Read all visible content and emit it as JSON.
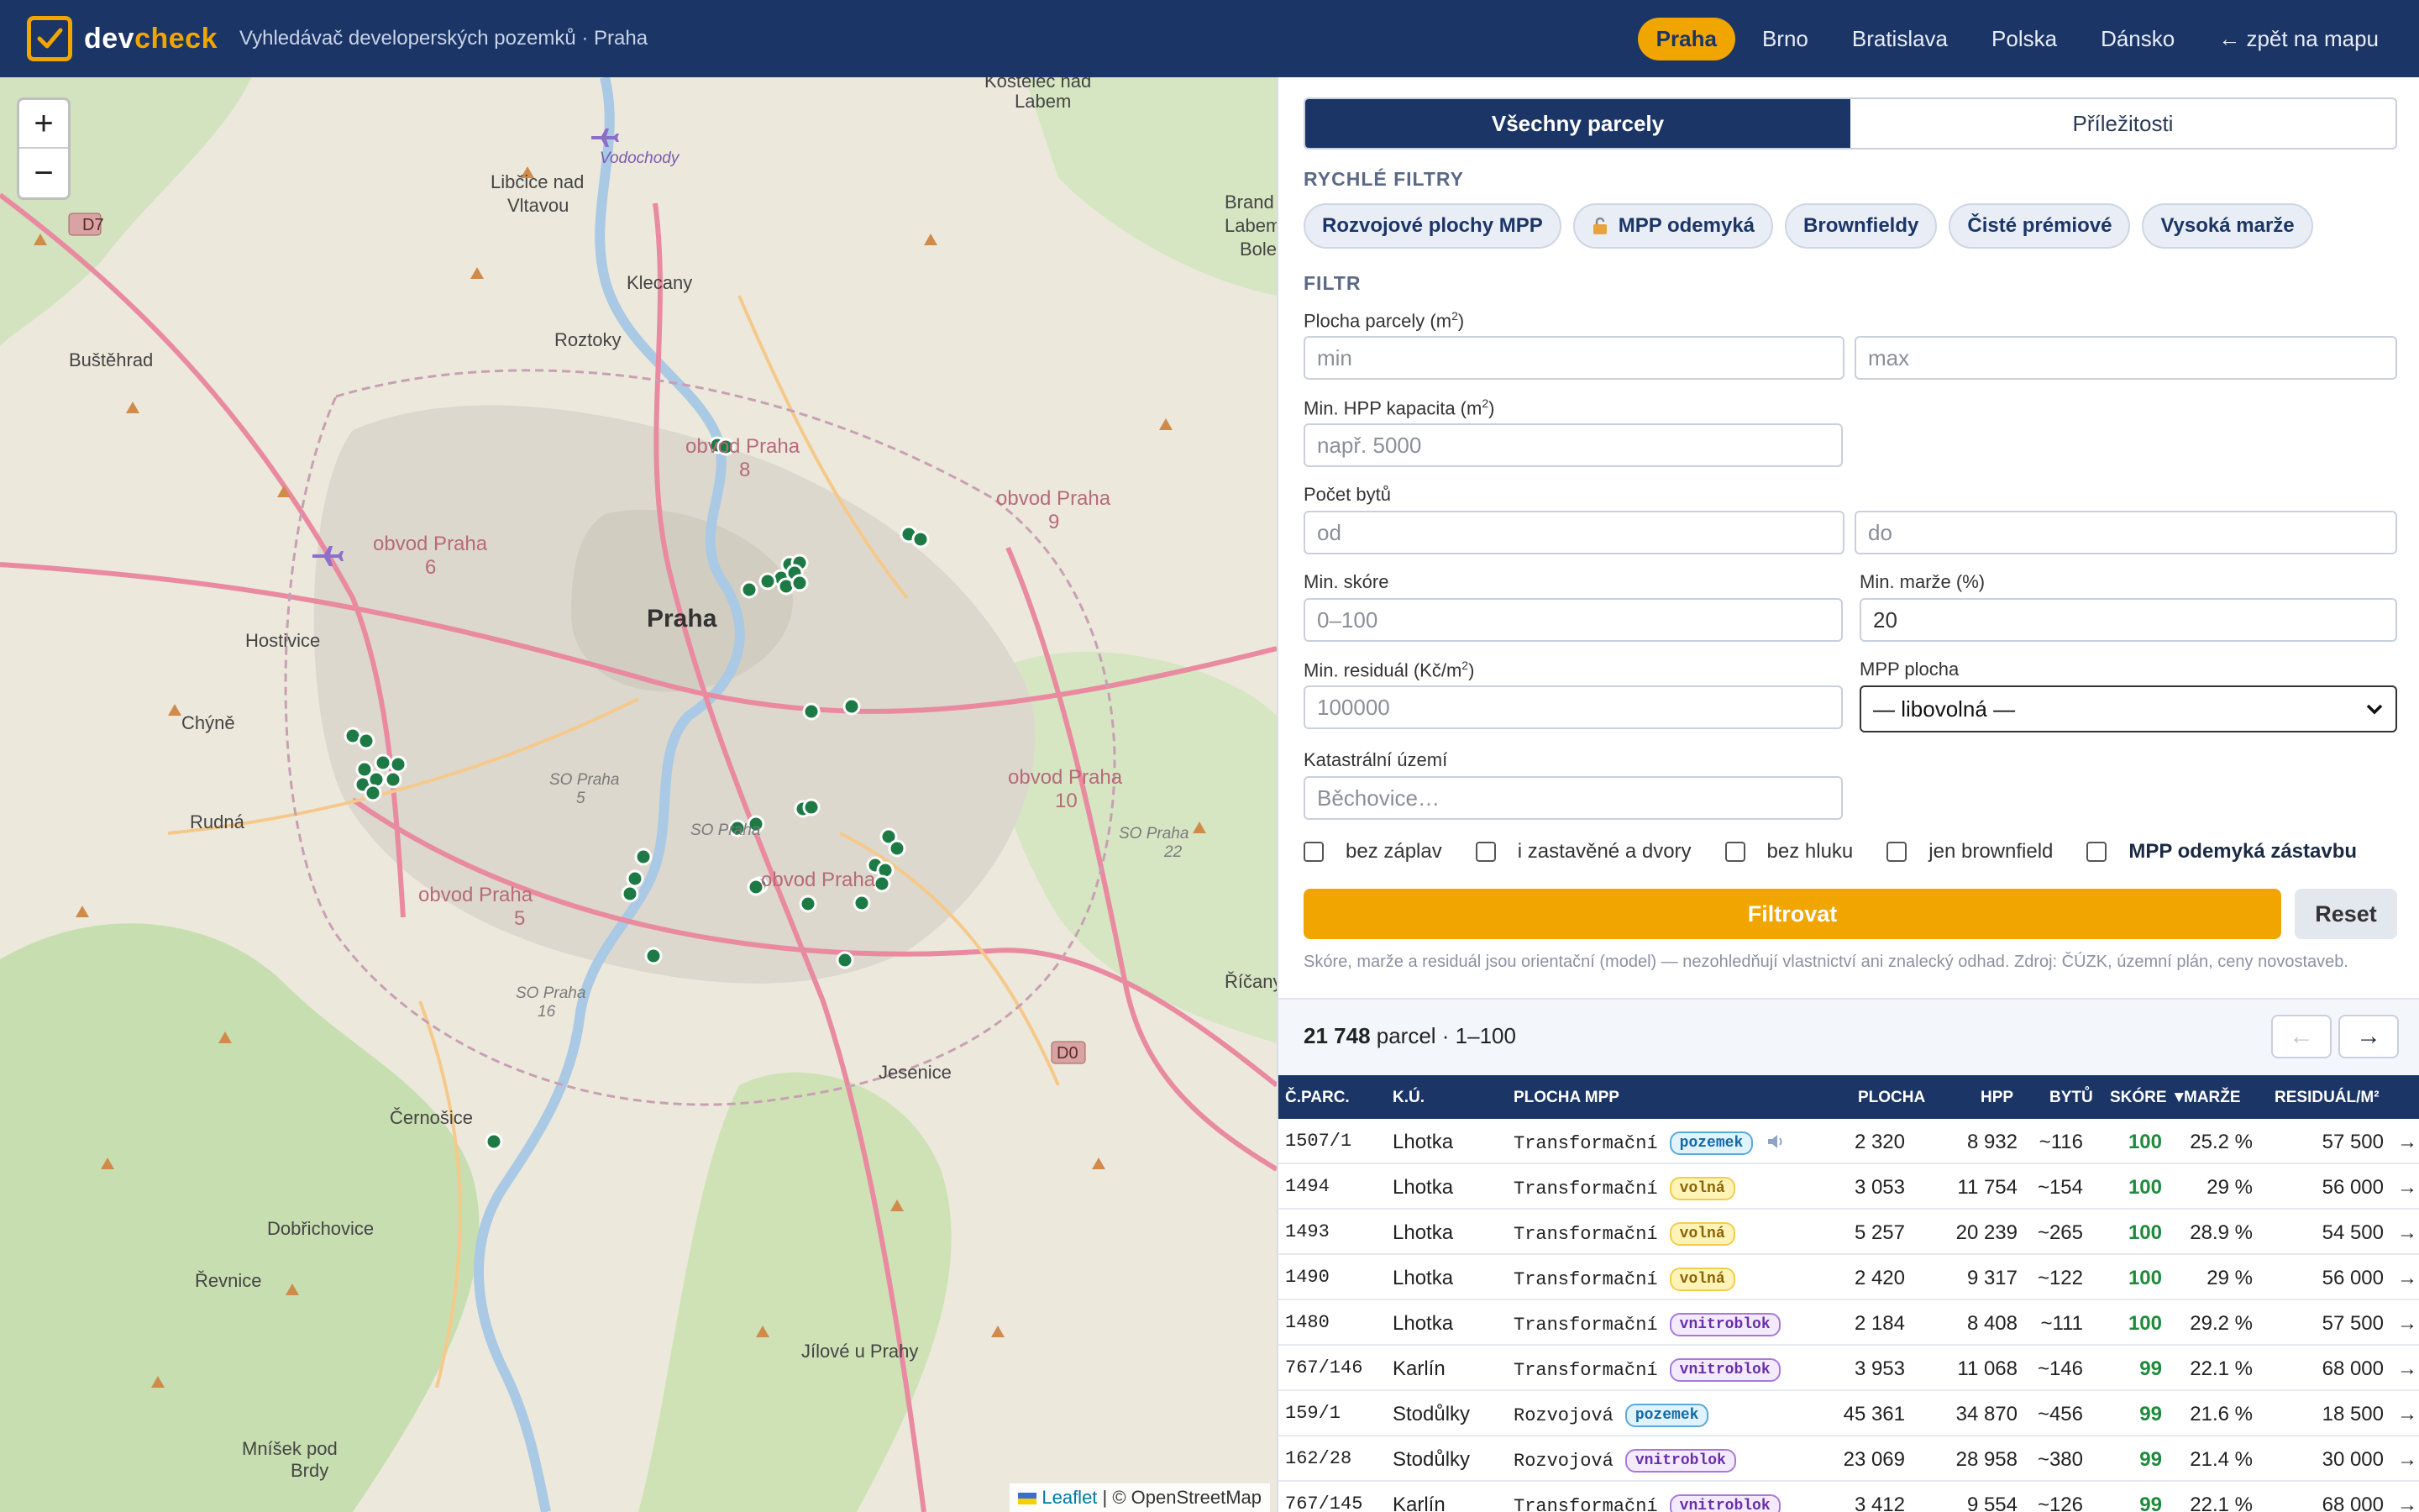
{
  "header": {
    "logo_dev": "dev",
    "logo_check": "check",
    "subtitle": "Vyhledávač developerských pozemků · Praha",
    "nav": [
      "Praha",
      "Brno",
      "Bratislava",
      "Polska",
      "Dánsko",
      "← zpět na mapu"
    ]
  },
  "map": {
    "zoom_in": "+",
    "zoom_out": "−",
    "attribution_leaflet": "Leaflet",
    "attribution_rest": " | © OpenStreetMap",
    "labels": {
      "praha": "Praha",
      "kostelec": "Kostelec nad",
      "labem": "Labem",
      "vodochody": "Vodochody",
      "libcice": "Libčice nad",
      "vltavou": "Vltavou",
      "klecany": "Klecany",
      "roztoky": "Roztoky",
      "bustehrad": "Buštěhrad",
      "hostivice": "Hostivice",
      "chyne": "Chýně",
      "rudna": "Rudná",
      "cernosice": "Černošice",
      "dobrichovice": "Dobřichovice",
      "revnice": "Řevnice",
      "jilove": "Jílové u Prahy",
      "mnisek1": "Mníšek pod",
      "mnisek2": "Brdy",
      "jesenice": "Jesenice",
      "ricany": "Říčany",
      "brandys1": "Brand",
      "brandys2": "Labem",
      "brandys3": "Bole",
      "obvod8": "obvod Praha",
      "obvod8n": "8",
      "obvod9": "obvod Praha",
      "obvod9n": "9",
      "obvod6": "obvod Praha",
      "obvod6n": "6",
      "obvod10": "obvod Praha",
      "obvod10n": "10",
      "obvod5": "obvod Praha",
      "obvod5n": "5",
      "obvod4": "obvod Praha",
      "so5": "SO Praha",
      "so5n": "5",
      "so4": "SO Praha",
      "so4n": "4",
      "so22": "SO Praha",
      "so22n": "22",
      "so16": "SO Praha",
      "so16n": "16",
      "d7": "D7",
      "d0": "D0"
    }
  },
  "tabs": [
    "Všechny parcely",
    "Příležitosti"
  ],
  "quick_filters": {
    "title": "RYCHLÉ FILTRY",
    "chips": [
      "Rozvojové plochy MPP",
      "MPP odemyká",
      "Brownfieldy",
      "Čisté prémiové",
      "Vysoká marže"
    ]
  },
  "filter": {
    "title": "FILTR",
    "plocha_label": "Plocha parcely (m",
    "plocha_min": "min",
    "plocha_max": "max",
    "hpp_label": "Min. HPP kapacita (m",
    "hpp_placeholder": "např. 5000",
    "byty_label": "Počet bytů",
    "byty_od": "od",
    "byty_do": "do",
    "skore_label": "Min. skóre",
    "skore_placeholder": "0–100",
    "marze_label": "Min. marže (%)",
    "marze_value": "20",
    "residual_label": "Min. residuál (Kč/m",
    "residual_placeholder": "100000",
    "mpp_label": "MPP plocha",
    "mpp_value": "— libovolná —",
    "katastr_label": "Katastrální území",
    "katastr_placeholder": "Běchovice…",
    "sup2": "2",
    "close_paren": ")",
    "checks": [
      "bez záplav",
      "i zastavěné a dvory",
      "bez hluku",
      "jen brownfield",
      "MPP odemyká zástavbu"
    ],
    "filter_button": "Filtrovat",
    "reset_button": "Reset",
    "note": "Skóre, marže a residuál jsou orientační (model) — nezohledňují vlastnictví ani znalecký odhad. Zdroj: ČÚZK, územní plán, ceny novostaveb."
  },
  "results": {
    "count": "21 748",
    "suffix": " parcel · 1–100",
    "prev": "←",
    "next": "→"
  },
  "table": {
    "headers": [
      "Č.PARC.",
      "K.Ú.",
      "PLOCHA MPP",
      "PLOCHA",
      "HPP",
      "BYTŮ",
      "SKÓRE ▼",
      "MARŽE",
      "RESIDUÁL/M²"
    ],
    "rows": [
      {
        "parc": "1507/1",
        "ku": "Lhotka",
        "mpp": "Transformační",
        "badge": "pozemek",
        "plocha": "2 320",
        "hpp": "8 932",
        "byty": "~116",
        "skore": "100",
        "marze": "25.2 %",
        "residual": "57 500",
        "arrow": "→"
      },
      {
        "parc": "1494",
        "ku": "Lhotka",
        "mpp": "Transformační",
        "badge": "volná",
        "plocha": "3 053",
        "hpp": "11 754",
        "byty": "~154",
        "skore": "100",
        "marze": "29 %",
        "residual": "56 000",
        "arrow": "→"
      },
      {
        "parc": "1493",
        "ku": "Lhotka",
        "mpp": "Transformační",
        "badge": "volná",
        "plocha": "5 257",
        "hpp": "20 239",
        "byty": "~265",
        "skore": "100",
        "marze": "28.9 %",
        "residual": "54 500",
        "arrow": "→"
      },
      {
        "parc": "1490",
        "ku": "Lhotka",
        "mpp": "Transformační",
        "badge": "volná",
        "plocha": "2 420",
        "hpp": "9 317",
        "byty": "~122",
        "skore": "100",
        "marze": "29 %",
        "residual": "56 000",
        "arrow": "→"
      },
      {
        "parc": "1480",
        "ku": "Lhotka",
        "mpp": "Transformační",
        "badge": "vnitroblok",
        "plocha": "2 184",
        "hpp": "8 408",
        "byty": "~111",
        "skore": "100",
        "marze": "29.2 %",
        "residual": "57 500",
        "arrow": "→"
      },
      {
        "parc": "767/146",
        "ku": "Karlín",
        "mpp": "Transformační",
        "badge": "vnitroblok",
        "plocha": "3 953",
        "hpp": "11 068",
        "byty": "~146",
        "skore": "99",
        "marze": "22.1 %",
        "residual": "68 000",
        "arrow": "→"
      },
      {
        "parc": "159/1",
        "ku": "Stodůlky",
        "mpp": "Rozvojová",
        "badge": "pozemek",
        "plocha": "45 361",
        "hpp": "34 870",
        "byty": "~456",
        "skore": "99",
        "marze": "21.6 %",
        "residual": "18 500",
        "arrow": "→"
      },
      {
        "parc": "162/28",
        "ku": "Stodůlky",
        "mpp": "Rozvojová",
        "badge": "vnitroblok",
        "plocha": "23 069",
        "hpp": "28 958",
        "byty": "~380",
        "skore": "99",
        "marze": "21.4 %",
        "residual": "30 000",
        "arrow": "→"
      },
      {
        "parc": "767/145",
        "ku": "Karlín",
        "mpp": "Transformační",
        "badge": "vnitroblok",
        "plocha": "3 412",
        "hpp": "9 554",
        "byty": "~126",
        "skore": "99",
        "marze": "22.1 %",
        "residual": "68 000",
        "arrow": "→"
      }
    ]
  },
  "colors": {
    "header": "#1b3566",
    "accent": "#f0a500",
    "marker": "#1e7a45",
    "score": "#1f8a3c"
  }
}
